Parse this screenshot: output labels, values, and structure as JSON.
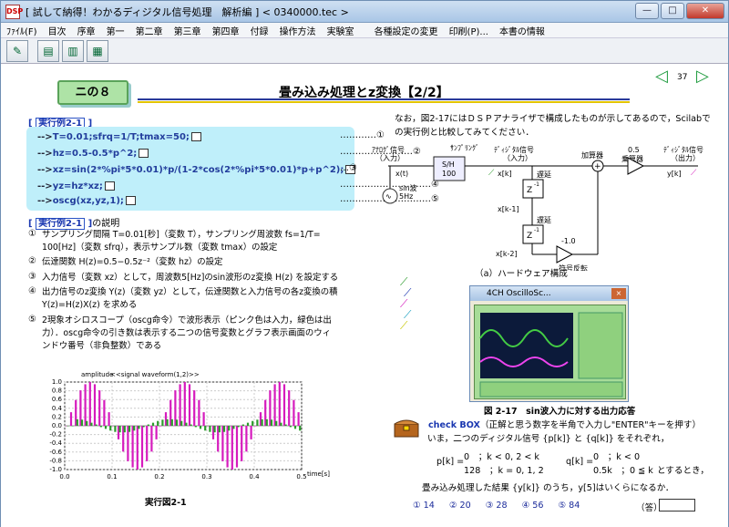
{
  "window": {
    "title": "[ 試して納得！わかるディジタル信号処理　解析編 ] < 0340000.tec >",
    "buttons": {
      "minimize": "—",
      "maximize": "□",
      "close": "✕"
    },
    "app_icon_text": "DSP"
  },
  "menu": [
    "ﾌｧｲﾙ(F)",
    "目次",
    "序章",
    "第一",
    "第二章",
    "第三章",
    "第四章",
    "付録",
    "操作方法",
    "実験室",
    "各種設定の変更",
    "印刷(P)...",
    "本書の情報"
  ],
  "page": {
    "badge": "ニの８",
    "title": "畳み込み処理とz変換【2/2】",
    "page_number": "37",
    "prev": "◁",
    "next": "▷"
  },
  "example": {
    "label": "実行例2-1",
    "desc_label": "実行例2-1",
    "desc_suffix": "の説明"
  },
  "code": {
    "prompt": "-->",
    "lines": [
      {
        "text": "T=0.01;sfrq=1/T;tmax=50;",
        "num": "…………①"
      },
      {
        "text": "hz=0.5-0.5*p^2;",
        "num": "……………………②"
      },
      {
        "text": "xz=sin(2*%pi*5*0.01)*p/(1-2*cos(2*%pi*5*0.01)*p+p^2);",
        "num": "…③"
      },
      {
        "text": "yz=hz*xz;",
        "num": "…………………………④"
      },
      {
        "text": "oscg(xz,yz,1);",
        "num": "…………………………⑤"
      }
    ]
  },
  "description": {
    "items": [
      {
        "num": "①",
        "lines": [
          "サンプリング間隔 T=0.01[秒]（変数 T），サンプリング周波数 fs=1/T=",
          "100[Hz]（変数 sfrq），表示サンプル数（変数 tmax）の設定"
        ]
      },
      {
        "num": "②",
        "lines": [
          "伝達関数 H(z)=0.5−0.5z⁻²（変数 hz）の設定"
        ]
      },
      {
        "num": "③",
        "lines": [
          "入力信号（変数 xz）として，周波数5[Hz]のsin波形のz変換 H(z) を設定する"
        ]
      },
      {
        "num": "④",
        "lines": [
          "出力信号のz変換 Y(z)（変数 yz）として，伝達関数と入力信号の各z変換の積",
          "Y(z)=H(z)X(z) を求める"
        ]
      },
      {
        "num": "⑤",
        "lines": [
          "2現象オシロスコープ（oscg命令）で波形表示（ピンク色は入力，緑色は出",
          "力）．oscg命令の引き数は表示する二つの信号変数とグラフ表示画面のウィ",
          "ンドウ番号（非負整数）である"
        ]
      }
    ]
  },
  "chart_data": {
    "type": "bar",
    "title": "<<signal waveform(1,2)>>",
    "ylabel": "amplitude",
    "xlabel": "time[s]",
    "xlim": [
      0,
      0.5
    ],
    "ylim": [
      -1,
      1
    ],
    "xticks": [
      "0.0",
      "0.1",
      "0.2",
      "0.3",
      "0.4",
      "0.5"
    ],
    "yticks": [
      "1.0",
      "0.8",
      "0.6",
      "0.4",
      "0.2",
      "0.0",
      "-0.2",
      "-0.4",
      "-0.6",
      "-0.8",
      "-1.0"
    ],
    "grid": true,
    "series": [
      {
        "color": "#d61bbd",
        "values": [
          0.0,
          0.31,
          0.59,
          0.81,
          0.95,
          1.0,
          0.95,
          0.81,
          0.59,
          0.31,
          0.0,
          -0.31,
          -0.59,
          -0.81,
          -0.95,
          -1.0,
          -0.95,
          -0.81,
          -0.59,
          -0.31,
          0.0,
          0.31,
          0.59,
          0.81,
          0.95,
          1.0,
          0.95,
          0.81,
          0.59,
          0.31,
          0.0,
          -0.31,
          -0.59,
          -0.81,
          -0.95,
          -1.0,
          -0.95,
          -0.81,
          -0.59,
          -0.31,
          0.0,
          0.31,
          0.59,
          0.81,
          0.95,
          1.0,
          0.95,
          0.81,
          0.59,
          0.31
        ]
      },
      {
        "color": "#2c9b2c",
        "values": [
          0.0,
          0.0,
          0.15,
          0.14,
          0.11,
          0.07,
          0.03,
          -0.03,
          -0.07,
          -0.11,
          -0.14,
          -0.15,
          -0.15,
          -0.14,
          -0.11,
          -0.07,
          -0.03,
          0.03,
          0.07,
          0.11,
          0.14,
          0.15,
          0.15,
          0.14,
          0.11,
          0.07,
          0.03,
          -0.03,
          -0.07,
          -0.11,
          -0.14,
          -0.15,
          -0.15,
          -0.14,
          -0.11,
          -0.07,
          -0.03,
          0.03,
          0.07,
          0.11,
          0.14,
          0.15,
          0.15,
          0.14,
          0.11,
          0.07,
          0.03,
          -0.03,
          -0.07,
          -0.11
        ]
      }
    ],
    "caption": "実行図2-1"
  },
  "right": {
    "intro_lines": [
      "なお，図2-17にはＤＳＰアナライザで構成したものが示してあるので，Scilabで",
      "の実行例と比較してみてください．"
    ],
    "diagram": {
      "analog_in": "ｱﾅﾛｸﾞ信号",
      "analog_in_sub": "（入力）",
      "sampling": "ｻﾝﾌﾟﾘﾝｸﾞ",
      "digital_in": "ﾃﾞｨｼﾞﾀﾙ信号",
      "digital_in_sub": "（入力）",
      "adder": "加算器",
      "mult_value": "0.5",
      "multiplier": "乗算器",
      "digital_out": "ﾃﾞｨｼﾞﾀﾙ信号",
      "digital_out_sub": "（出力）",
      "xt": "x(t)",
      "sh": "S/H",
      "sh_rate": "100",
      "xk": "x[k]",
      "yk": "y[k]",
      "delay": "遅延",
      "zinv": "Z",
      "zexp": "-1",
      "xk1": "x[k-1]",
      "xk2": "x[k-2]",
      "gain2": "-1.0",
      "sign_inv": "符号反転",
      "source": "sin波",
      "source_freq": "5Hz",
      "caption": "（a）ハードウェア構成"
    },
    "osc": {
      "title": "4CH OscilloSc...",
      "close": "×"
    },
    "figure_caption": "図 2-17　sin波入力に対する出力応答",
    "check": {
      "label": "check BOX",
      "rest": "（正解と思う数字を半角で入力し\"ENTER\"キーを押す）",
      "line1": "いま，二つのディジタル信号 {p[k]} と {q[k]} をそれぞれ，",
      "p_label": "p[k] =",
      "p_case1": "0　；k < 0, 2 < k",
      "p_case2": "128　；k = 0, 1, 2",
      "q_label": "q[k] =",
      "q_case1": "0　；k < 0",
      "q_case2": "0.5k　；0 ≦ k",
      "q_tail": "とするとき，",
      "question": "畳み込み処理した結果 {y[k]} のうち，y[5]はいくらになるか．",
      "choices": [
        "① 14",
        "② 20",
        "③ 28",
        "④ 56",
        "⑤ 84"
      ],
      "answer_prefix": "（答）"
    }
  }
}
